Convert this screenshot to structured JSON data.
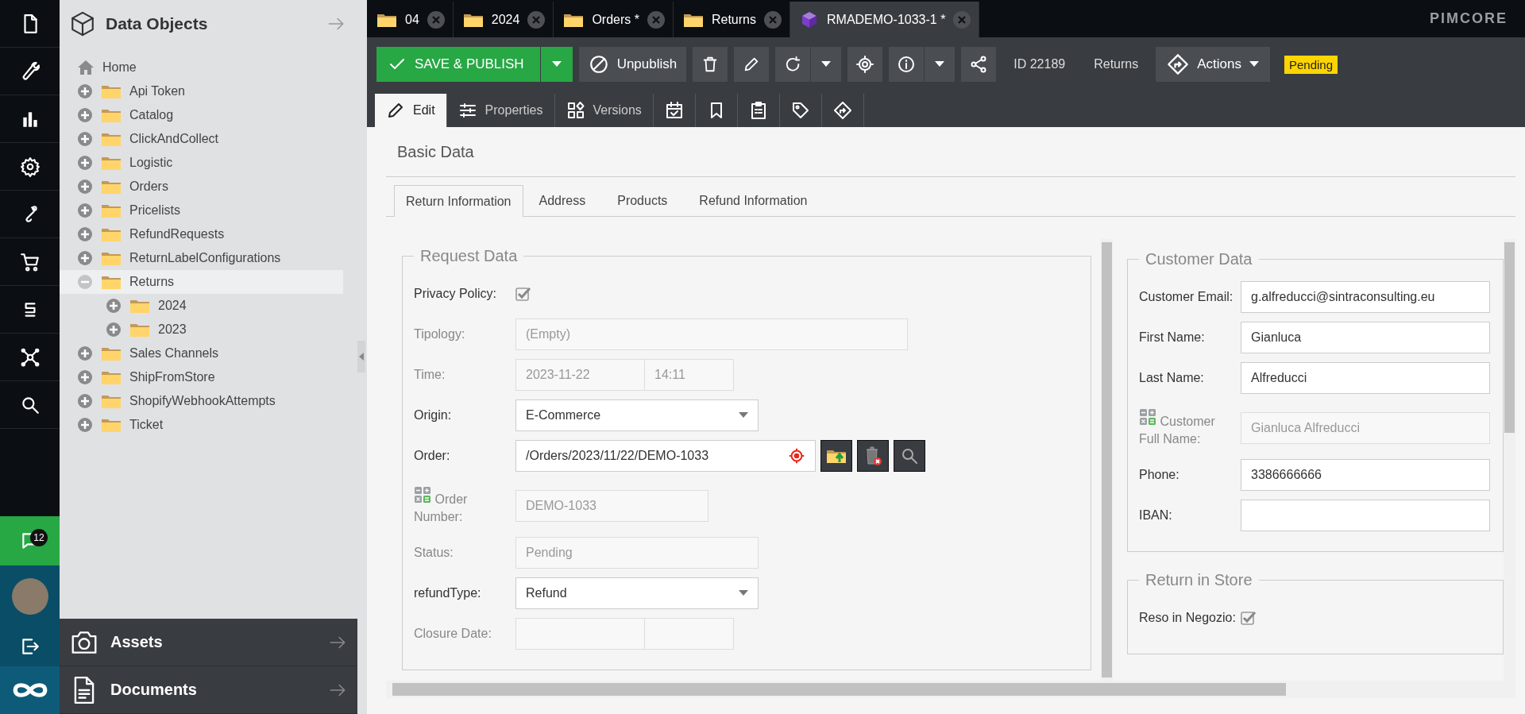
{
  "nav_rail": {
    "notification_count": "12"
  },
  "tree": {
    "title": "Data Objects",
    "root": {
      "label": "Home",
      "children": [
        {
          "label": "Api Token",
          "expanded": false,
          "selected": false
        },
        {
          "label": "Catalog",
          "expanded": false,
          "selected": false
        },
        {
          "label": "ClickAndCollect",
          "expanded": false,
          "selected": false
        },
        {
          "label": "Logistic",
          "expanded": false,
          "selected": false
        },
        {
          "label": "Orders",
          "expanded": false,
          "selected": false
        },
        {
          "label": "Pricelists",
          "expanded": false,
          "selected": false
        },
        {
          "label": "RefundRequests",
          "expanded": false,
          "selected": false
        },
        {
          "label": "ReturnLabelConfigurations",
          "expanded": false,
          "selected": false
        },
        {
          "label": "Returns",
          "expanded": true,
          "selected": true,
          "children": [
            {
              "label": "2024",
              "expanded": false,
              "selected": false
            },
            {
              "label": "2023",
              "expanded": false,
              "selected": false
            }
          ]
        },
        {
          "label": "Sales Channels",
          "expanded": false,
          "selected": false
        },
        {
          "label": "ShipFromStore",
          "expanded": false,
          "selected": false
        },
        {
          "label": "ShopifyWebhookAttempts",
          "expanded": false,
          "selected": false
        },
        {
          "label": "Ticket",
          "expanded": false,
          "selected": false
        }
      ]
    }
  },
  "bottom_panels": [
    {
      "label": "Assets",
      "kind": "camera"
    },
    {
      "label": "Documents",
      "kind": "document"
    }
  ],
  "editor_tabs": [
    {
      "label": "04",
      "kind": "folder",
      "selected": false
    },
    {
      "label": "2024",
      "kind": "folder",
      "selected": false
    },
    {
      "label": "Orders *",
      "kind": "folder",
      "selected": false
    },
    {
      "label": "Returns",
      "kind": "folder",
      "selected": false
    },
    {
      "label": "RMADEMO-1033-1 *",
      "kind": "object",
      "selected": true
    }
  ],
  "brand": "PIMCORE",
  "toolbar": {
    "save_button": "SAVE & PUBLISH",
    "unpublish_button": "Unpublish",
    "object_id": "ID 22189",
    "class_name": "Returns",
    "actions_button": "Actions",
    "status_badge": "Pending"
  },
  "subtabs": [
    {
      "label": "Edit",
      "kind": "edit",
      "selected": true
    },
    {
      "label": "Properties",
      "kind": "properties",
      "selected": false
    },
    {
      "label": "Versions",
      "kind": "versions",
      "selected": false
    },
    {
      "kind": "schedule",
      "selected": false
    },
    {
      "kind": "bookmark",
      "selected": false
    },
    {
      "kind": "notes",
      "selected": false
    },
    {
      "kind": "tag",
      "selected": false
    },
    {
      "kind": "workflow",
      "selected": false
    }
  ],
  "layout_title": "Basic Data",
  "form_tabs": [
    {
      "label": "Return Information",
      "selected": true
    },
    {
      "label": "Address",
      "selected": false
    },
    {
      "label": "Products",
      "selected": false
    },
    {
      "label": "Refund Information",
      "selected": false
    }
  ],
  "request_data": {
    "title": "Request Data",
    "fields": [
      {
        "kind": "checkbox",
        "label": "Privacy Policy:",
        "checked": true,
        "disabled": false
      },
      {
        "kind": "text",
        "label": "Tipology:",
        "value": "(Empty)",
        "disabled": true
      },
      {
        "kind": "datetime",
        "label": "Time:",
        "date": "2023-11-22",
        "time": "14:11",
        "disabled": true
      },
      {
        "kind": "select",
        "label": "Origin:",
        "value": "E-Commerce",
        "disabled": false
      },
      {
        "kind": "relation",
        "label": "Order:",
        "value": "/Orders/2023/11/22/DEMO-1033",
        "disabled": false
      },
      {
        "kind": "calculated",
        "label": "Order Number:",
        "value": "DEMO-1033",
        "disabled": true
      },
      {
        "kind": "text",
        "label": "Status:",
        "value": "Pending",
        "disabled": true
      },
      {
        "kind": "select",
        "label": "refundType:",
        "value": "Refund",
        "disabled": false
      },
      {
        "kind": "datetime",
        "label": "Closure Date:",
        "disabled": true
      }
    ]
  },
  "customer_data": {
    "title": "Customer Data",
    "fields": [
      {
        "kind": "text",
        "label": "Customer Email:",
        "value": "g.alfreducci@sintraconsulting.eu",
        "disabled": false
      },
      {
        "kind": "text",
        "label": "First Name:",
        "value": "Gianluca",
        "disabled": false
      },
      {
        "kind": "text",
        "label": "Last Name:",
        "value": "Alfreducci",
        "disabled": false
      },
      {
        "kind": "calculated",
        "label": "Customer Full Name:",
        "value": "Gianluca Alfreducci",
        "disabled": true
      },
      {
        "kind": "text",
        "label": "Phone:",
        "value": "3386666666",
        "disabled": false
      },
      {
        "kind": "text",
        "label": "IBAN:",
        "disabled": false
      }
    ]
  },
  "return_in_store": {
    "title": "Return in Store",
    "fields": [
      {
        "kind": "checkbox",
        "label": "Reso in Negozio:",
        "checked": true,
        "disabled": false
      }
    ]
  }
}
